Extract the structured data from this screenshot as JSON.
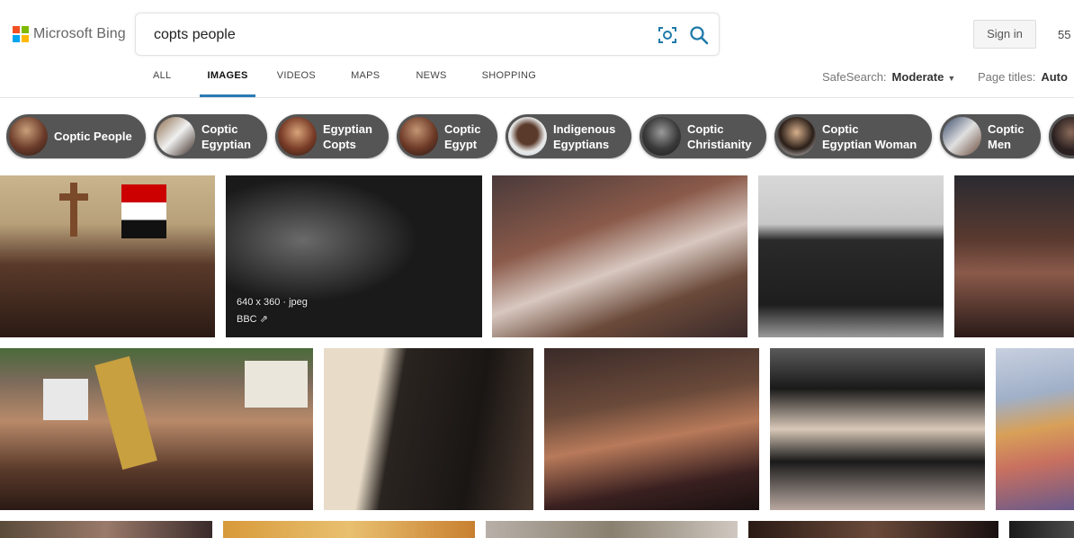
{
  "brand": {
    "name": "Microsoft Bing",
    "colors": [
      "#f25022",
      "#7fba00",
      "#00a4ef",
      "#ffb900"
    ]
  },
  "search": {
    "query": "copts people",
    "visual_search_icon": "camera-scan-icon",
    "search_icon": "magnifier-icon",
    "accent": "#1f7aa8"
  },
  "header": {
    "signin_label": "Sign in",
    "rewards_count": "55"
  },
  "nav": {
    "items": [
      {
        "label": "ALL"
      },
      {
        "label": "IMAGES",
        "active": true
      },
      {
        "label": "VIDEOS"
      },
      {
        "label": "MAPS"
      },
      {
        "label": "NEWS"
      },
      {
        "label": "SHOPPING"
      }
    ]
  },
  "filters": {
    "safesearch_label": "SafeSearch:",
    "safesearch_value": "Moderate",
    "pagetitles_label": "Page titles:",
    "pagetitles_value": "Auto"
  },
  "related": [
    {
      "label": "Coptic People"
    },
    {
      "label": "Coptic\nEgyptian"
    },
    {
      "label": "Egyptian\nCopts"
    },
    {
      "label": "Coptic\nEgypt"
    },
    {
      "label": "Indigenous\nEgyptians"
    },
    {
      "label": "Coptic\nChristianity"
    },
    {
      "label": "Coptic\nEgyptian Woman"
    },
    {
      "label": "Coptic\nMen"
    }
  ],
  "results": {
    "hover": {
      "dimensions": "640 x 360 · jpeg",
      "source": "BBC"
    }
  }
}
